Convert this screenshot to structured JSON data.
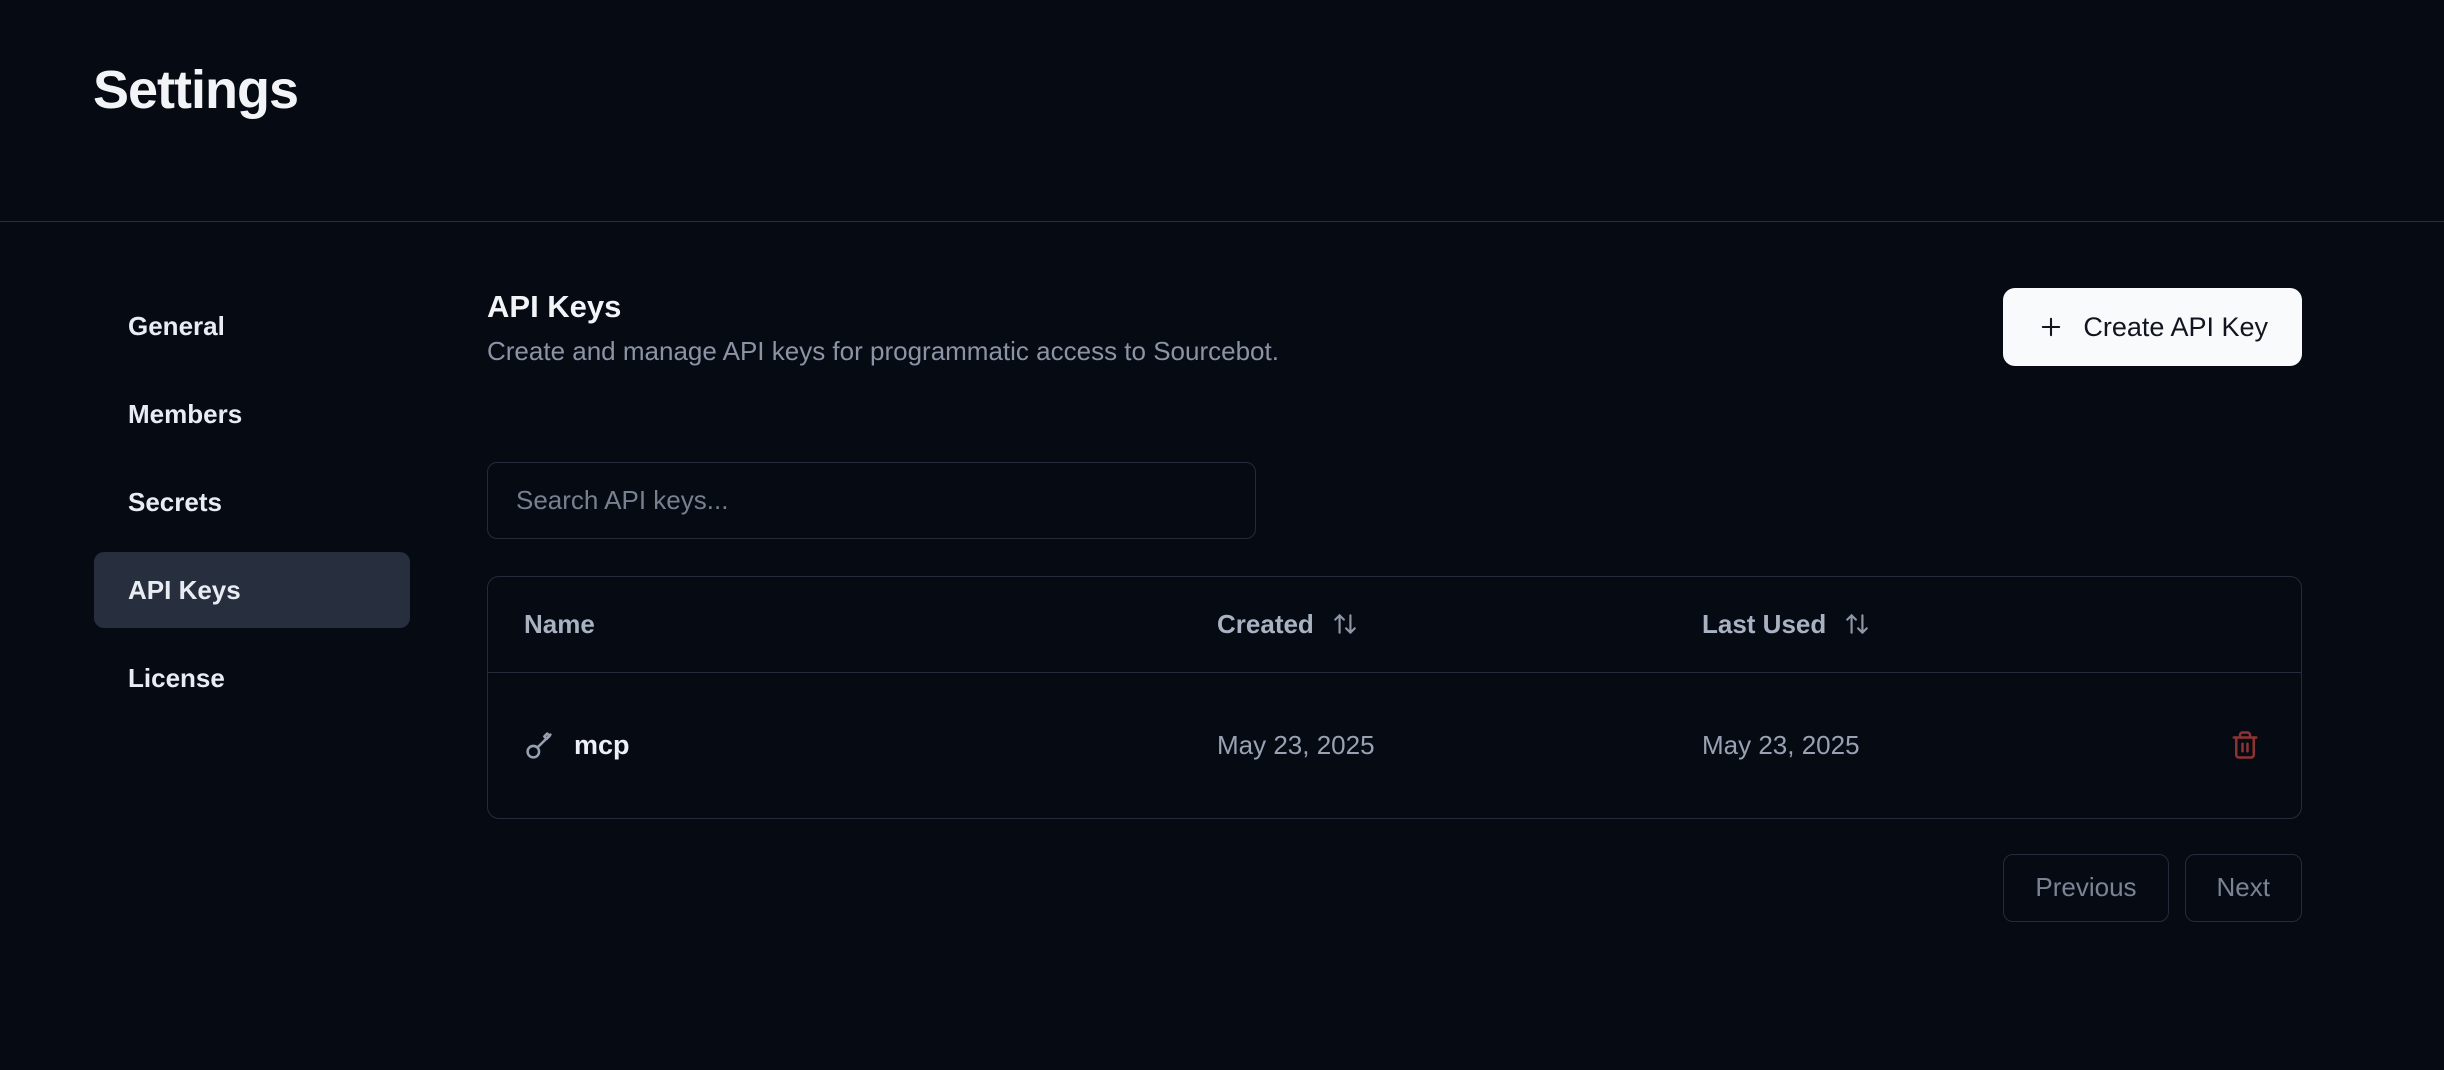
{
  "page": {
    "title": "Settings"
  },
  "sidebar": {
    "items": [
      {
        "label": "General",
        "active": false
      },
      {
        "label": "Members",
        "active": false
      },
      {
        "label": "Secrets",
        "active": false
      },
      {
        "label": "API Keys",
        "active": true
      },
      {
        "label": "License",
        "active": false
      }
    ]
  },
  "main": {
    "heading": "API Keys",
    "description": "Create and manage API keys for programmatic access to Sourcebot.",
    "create_button": {
      "label": "Create API Key",
      "icon": "plus"
    },
    "search": {
      "placeholder": "Search API keys...",
      "value": ""
    },
    "table": {
      "columns": [
        {
          "label": "Name",
          "sortable": false
        },
        {
          "label": "Created",
          "sortable": true,
          "sort_icon": "arrow-up-down"
        },
        {
          "label": "Last Used",
          "sortable": true,
          "sort_icon": "arrow-up-down"
        }
      ],
      "rows": [
        {
          "icon": "key",
          "name": "mcp",
          "created": "May 23, 2025",
          "last_used": "May 23, 2025",
          "action_icon": "trash"
        }
      ]
    },
    "pagination": {
      "previous_label": "Previous",
      "next_label": "Next"
    }
  },
  "colors": {
    "background": "#050a13",
    "border": "#242c3c",
    "active_nav_bg": "#272e3e",
    "primary_button_bg": "#f8fafc",
    "primary_button_text": "#10151f",
    "muted_text": "#8b93a5",
    "destructive_icon": "#8e3333"
  }
}
